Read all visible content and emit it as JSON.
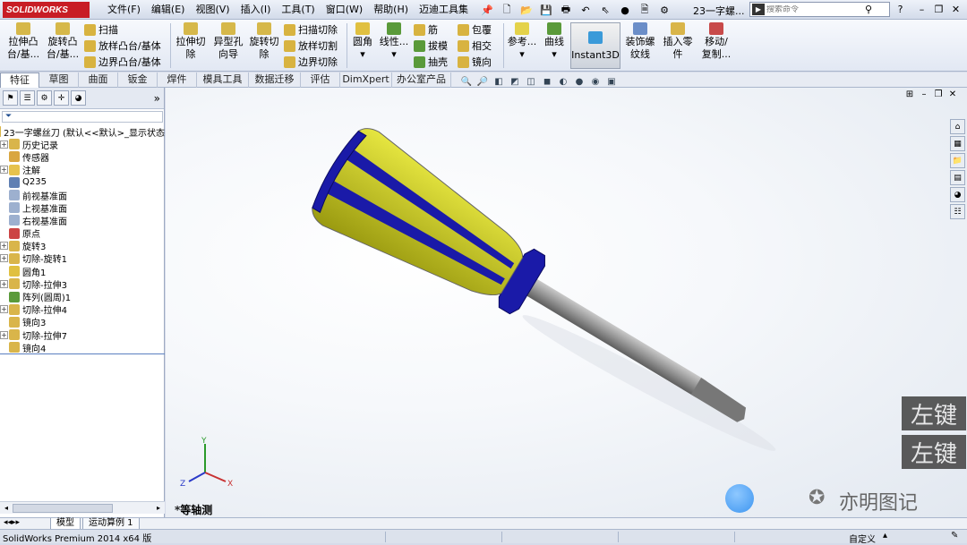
{
  "app": {
    "logo_text": "SOLIDWORKS"
  },
  "menu": [
    "文件(F)",
    "编辑(E)",
    "视图(V)",
    "插入(I)",
    "工具(T)",
    "窗口(W)",
    "帮助(H)",
    "迈迪工具集"
  ],
  "doc_title": "23一字螺...",
  "search": {
    "placeholder": "搜索命令"
  },
  "ribbon": {
    "extrude_boss": "拉伸凸\n台/基...",
    "revolve_boss": "旋转凸\n台/基...",
    "sweep": "扫描",
    "loft_boss": "放样凸台/基体",
    "boundary_boss": "边界凸台/基体",
    "extrude_cut": "拉伸切\n除",
    "hole_wizard": "异型孔\n向导",
    "revolve_cut": "旋转切\n除",
    "sweep_cut": "扫描切除",
    "loft_cut": "放样切割",
    "boundary_cut": "边界切除",
    "fillet": "圆角",
    "linear_pattern": "线性...",
    "rib": "筋",
    "draft": "拔模",
    "shell": "抽壳",
    "wrap": "包覆",
    "intersect": "相交",
    "mirror": "镜向",
    "reference": "参考...",
    "curves": "曲线",
    "instant3d": "Instant3D",
    "cosmetic_thread": "装饰螺\n纹线",
    "insert_part": "插入零\n件",
    "move_copy": "移动/\n复制..."
  },
  "tabs": [
    "特征",
    "草图",
    "曲面",
    "钣金",
    "焊件",
    "模具工具",
    "数据迁移",
    "评估",
    "DimXpert",
    "办公室产品"
  ],
  "tree": {
    "root": "23一字螺丝刀  (默认<<默认>_显示状态",
    "items": [
      {
        "label": "历史记录",
        "expand": true,
        "icon": "history-icon",
        "color": "#d9b54a"
      },
      {
        "label": "传感器",
        "expand": false,
        "icon": "sensor-icon",
        "color": "#d9a640"
      },
      {
        "label": "注解",
        "expand": true,
        "icon": "annotation-icon",
        "color": "#e6c24d"
      },
      {
        "label": "Q235",
        "expand": false,
        "icon": "material-icon",
        "color": "#5f7fb3"
      },
      {
        "label": "前视基准面",
        "expand": false,
        "icon": "plane-icon",
        "color": "#9db0cf"
      },
      {
        "label": "上视基准面",
        "expand": false,
        "icon": "plane-icon",
        "color": "#9db0cf"
      },
      {
        "label": "右视基准面",
        "expand": false,
        "icon": "plane-icon",
        "color": "#9db0cf"
      },
      {
        "label": "原点",
        "expand": false,
        "icon": "origin-icon",
        "color": "#c44"
      },
      {
        "label": "旋转3",
        "expand": true,
        "icon": "revolve-icon",
        "color": "#d9b54a"
      },
      {
        "label": "切除-旋转1",
        "expand": true,
        "icon": "cut-revolve-icon",
        "color": "#d9b54a"
      },
      {
        "label": "圆角1",
        "expand": false,
        "icon": "fillet-icon",
        "color": "#e0c040"
      },
      {
        "label": "切除-拉伸3",
        "expand": true,
        "icon": "cut-extrude-icon",
        "color": "#d9b54a"
      },
      {
        "label": "阵列(圆周)1",
        "expand": false,
        "icon": "pattern-icon",
        "color": "#5a9a3a"
      },
      {
        "label": "切除-拉伸4",
        "expand": true,
        "icon": "cut-extrude-icon",
        "color": "#d9b54a"
      },
      {
        "label": "镜向3",
        "expand": false,
        "icon": "mirror-icon",
        "color": "#d9b54a"
      },
      {
        "label": "切除-拉伸7",
        "expand": true,
        "icon": "cut-extrude-icon",
        "color": "#d9b54a"
      },
      {
        "label": "镜向4",
        "expand": false,
        "icon": "mirror-icon",
        "color": "#d9b54a"
      }
    ]
  },
  "viewport": {
    "view_name": "*等轴测",
    "key_label_1": "左键",
    "key_label_2": "左键",
    "watermark": "亦明图记"
  },
  "bottom_tabs": [
    "模型",
    "运动算例 1"
  ],
  "status": {
    "text": "SolidWorks Premium 2014 x64 版",
    "custom": "自定义"
  },
  "colors": {
    "handle_yellow": "#c8c800",
    "handle_blue": "#1a1aa8",
    "shaft_gray": "#8a8a8a",
    "accent": "#c81d25"
  }
}
